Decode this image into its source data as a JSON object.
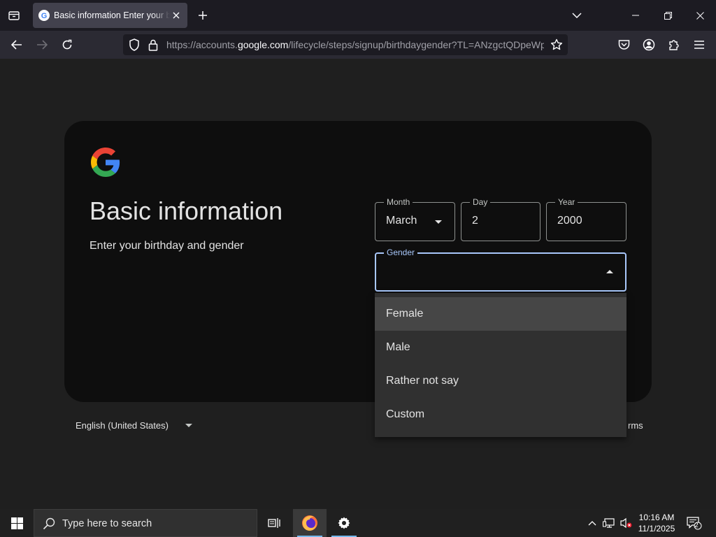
{
  "browser": {
    "tab": {
      "title": "Basic information Enter your birthday and gender"
    },
    "url": {
      "prefix": "https://accounts.",
      "domain": "google.com",
      "path": "/lifecycle/steps/signup/birthdaygender?TL=ANzgctQDpeWp"
    }
  },
  "page": {
    "heading": "Basic information",
    "subheading": "Enter your birthday and gender",
    "birthday": {
      "month": {
        "label": "Month",
        "value": "March"
      },
      "day": {
        "label": "Day",
        "value": "2"
      },
      "year": {
        "label": "Year",
        "value": "2000"
      }
    },
    "gender": {
      "label": "Gender",
      "value": "",
      "options": [
        "Female",
        "Male",
        "Rather not say",
        "Custom"
      ],
      "highlighted": "Female"
    },
    "footer": {
      "language": "English (United States)",
      "terms_partial": "rms"
    }
  },
  "taskbar": {
    "search_placeholder": "Type here to search",
    "time": "10:16 AM",
    "date": "11/1/2025",
    "notification_count": "2"
  },
  "colors": {
    "focus_accent": "#a8c7fa",
    "card_bg": "#0e0e0e",
    "page_bg": "#1f1f1f"
  }
}
